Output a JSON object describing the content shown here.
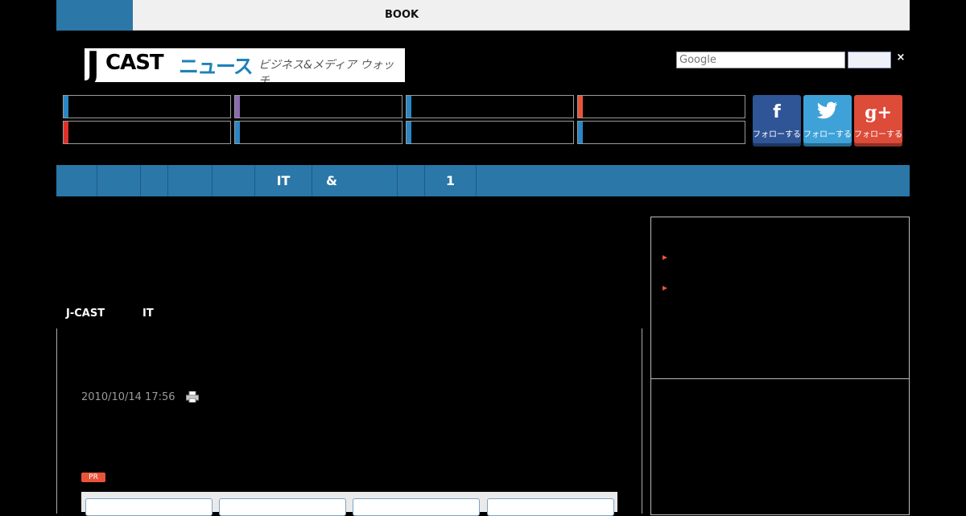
{
  "topbar": {
    "book_label": "BOOK"
  },
  "logo": {
    "j": "J",
    "cast": "CAST",
    "news": "ニュース",
    "tagline": "ビジネス&メディア ウォッチ"
  },
  "search": {
    "placeholder": "Google",
    "close": "×"
  },
  "categories": [
    {
      "color": "#2a86c4"
    },
    {
      "color": "#8a6bb0"
    },
    {
      "color": "#2a86c4"
    },
    {
      "color": "#e8543a"
    },
    {
      "color": "#e0302a"
    },
    {
      "color": "#2a86c4"
    },
    {
      "color": "#2a86c4"
    },
    {
      "color": "#2a86c4"
    }
  ],
  "social": [
    {
      "icon": "f",
      "label": "フォローする",
      "color": "#2f5597"
    },
    {
      "icon": "t",
      "label": "フォローする",
      "color": "#3ea2d8"
    },
    {
      "icon": "g+",
      "label": "フォローする",
      "color": "#dd4b39"
    }
  ],
  "nav": [
    "",
    "",
    "",
    "",
    "",
    "IT",
    "&",
    "",
    "1"
  ],
  "breadcrumb": [
    "J-CAST",
    "IT"
  ],
  "article": {
    "date": "2010/10/14 17:56"
  },
  "ad": {
    "pr_label": "PR"
  }
}
